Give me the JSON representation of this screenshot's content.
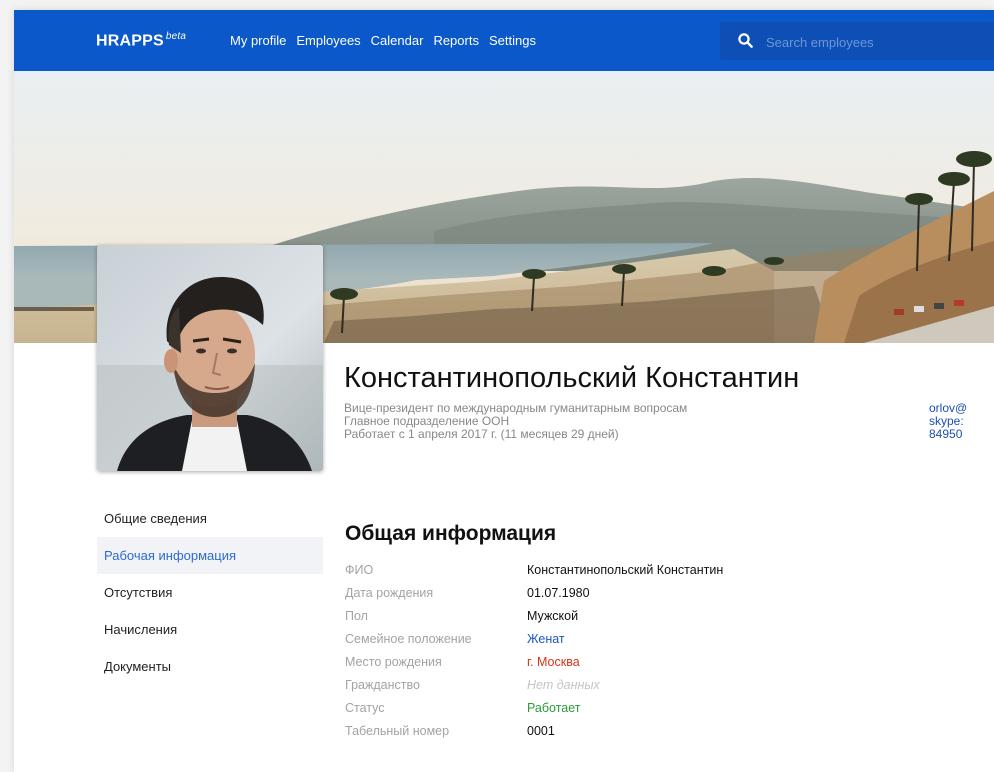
{
  "header": {
    "logo": "HRAPPS",
    "logo_badge": "beta",
    "nav": [
      "My profile",
      "Employees",
      "Calendar",
      "Reports",
      "Settings"
    ],
    "search_placeholder": "Search employees",
    "search_icon": "search-icon"
  },
  "profile": {
    "name": "Константинопольский Константин",
    "position": "Вице-президент по международным гуманитарным вопросам",
    "department": "Главное подразделение ООН",
    "tenure": "Работает с 1 апреля 2017 г. (11 месяцев 29 дней)",
    "contacts": {
      "email": "orlov@",
      "skype": "skype:",
      "phone": "84950"
    }
  },
  "sidebar": {
    "items": [
      {
        "label": "Общие сведения",
        "active": false
      },
      {
        "label": "Рабочая информация",
        "active": true
      },
      {
        "label": "Отсутствия",
        "active": false
      },
      {
        "label": "Начисления",
        "active": false
      },
      {
        "label": "Документы",
        "active": false
      }
    ]
  },
  "section": {
    "title": "Общая информация",
    "rows": [
      {
        "label": "ФИО",
        "value": "Константинопольский Константин",
        "style": "default"
      },
      {
        "label": "Дата рождения",
        "value": "01.07.1980",
        "style": "default"
      },
      {
        "label": "Пол",
        "value": "Мужской",
        "style": "default"
      },
      {
        "label": "Семейное положение",
        "value": "Женат",
        "style": "blue"
      },
      {
        "label": "Место рождения",
        "value": "г. Москва",
        "style": "red"
      },
      {
        "label": "Гражданство",
        "value": "Нет данных",
        "style": "muted"
      },
      {
        "label": "Статус",
        "value": "Работает",
        "style": "green"
      },
      {
        "label": "Табельный номер",
        "value": "0001",
        "style": "default"
      }
    ]
  },
  "colors": {
    "brand": "#0a58c9",
    "link": "#1a56c8",
    "active_menu": "#2d6bd2",
    "red": "#d6341a",
    "green": "#2c9a3a"
  }
}
